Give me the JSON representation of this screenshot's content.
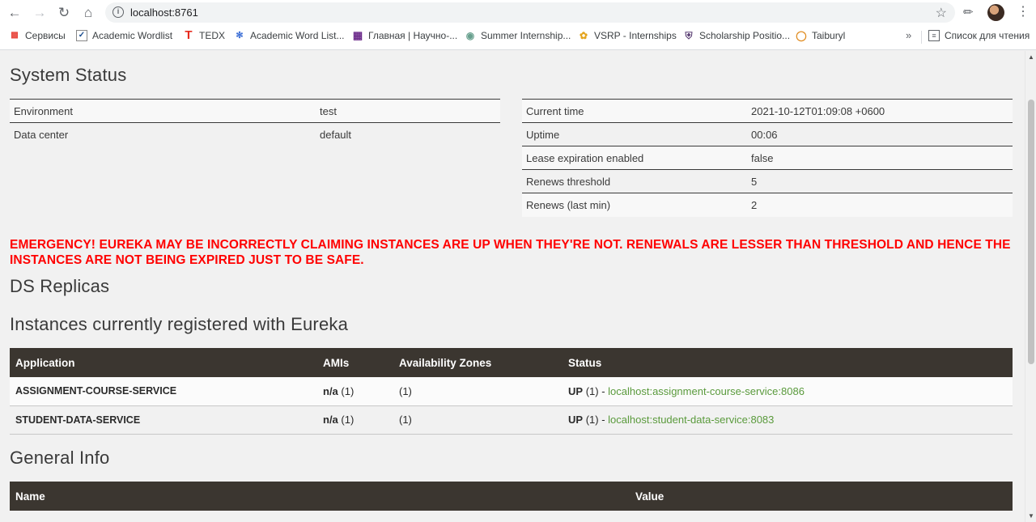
{
  "browser": {
    "url": "localhost:8761",
    "bookmarks": [
      {
        "label": "Сервисы",
        "icon": "apps-icon"
      },
      {
        "label": "Academic Wordlist",
        "icon": "checkbox-icon"
      },
      {
        "label": "TEDX",
        "icon": "tedx-icon"
      },
      {
        "label": "Academic Word List...",
        "icon": "awl-icon"
      },
      {
        "label": "Главная | Научно-...",
        "icon": "building-icon"
      },
      {
        "label": "Summer Internship...",
        "icon": "globe-icon"
      },
      {
        "label": "VSRP - Internships",
        "icon": "flower-icon"
      },
      {
        "label": "Scholarship Positio...",
        "icon": "shield-icon"
      },
      {
        "label": "Taiburyl",
        "icon": "ring-icon"
      }
    ],
    "more": "»",
    "reading_list": "Список для чтения"
  },
  "system_status": {
    "title": "System Status",
    "left": [
      {
        "key": "Environment",
        "value": "test"
      },
      {
        "key": "Data center",
        "value": "default"
      }
    ],
    "right": [
      {
        "key": "Current time",
        "value": "2021-10-12T01:09:08 +0600"
      },
      {
        "key": "Uptime",
        "value": "00:06"
      },
      {
        "key": "Lease expiration enabled",
        "value": "false"
      },
      {
        "key": "Renews threshold",
        "value": "5"
      },
      {
        "key": "Renews (last min)",
        "value": "2"
      }
    ]
  },
  "emergency": "EMERGENCY! EUREKA MAY BE INCORRECTLY CLAIMING INSTANCES ARE UP WHEN THEY'RE NOT. RENEWALS ARE LESSER THAN THRESHOLD AND HENCE THE INSTANCES ARE NOT BEING EXPIRED JUST TO BE SAFE.",
  "ds_replicas": {
    "title": "DS Replicas"
  },
  "instances": {
    "title": "Instances currently registered with Eureka",
    "headers": [
      "Application",
      "AMIs",
      "Availability Zones",
      "Status"
    ],
    "rows": [
      {
        "application": "ASSIGNMENT-COURSE-SERVICE",
        "ami_bold": "n/a",
        "ami_count": "(1)",
        "zones": "(1)",
        "status_bold": "UP",
        "status_count": "(1) -",
        "link": "localhost:assignment-course-service:8086"
      },
      {
        "application": "STUDENT-DATA-SERVICE",
        "ami_bold": "n/a",
        "ami_count": "(1)",
        "zones": "(1)",
        "status_bold": "UP",
        "status_count": "(1) -",
        "link": "localhost:student-data-service:8083"
      }
    ]
  },
  "general_info": {
    "title": "General Info",
    "headers": [
      "Name",
      "Value"
    ]
  }
}
